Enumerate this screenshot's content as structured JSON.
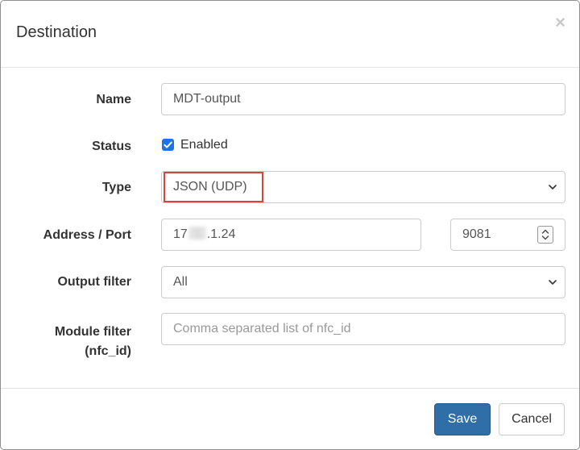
{
  "dialog": {
    "title": "Destination",
    "close_glyph": "×"
  },
  "form": {
    "name": {
      "label": "Name",
      "value": "MDT-output"
    },
    "status": {
      "label": "Status",
      "checkbox_label": "Enabled",
      "checked": true
    },
    "type": {
      "label": "Type",
      "selected": "JSON (UDP)"
    },
    "address": {
      "label": "Address / Port",
      "value_start": "17",
      "value_end": ".1.24",
      "port": "9081"
    },
    "output_filter": {
      "label": "Output filter",
      "selected": "All"
    },
    "module_filter": {
      "label_line1": "Module filter",
      "label_line2": "(nfc_id)",
      "placeholder": "Comma separated list of nfc_id"
    }
  },
  "footer": {
    "save_label": "Save",
    "cancel_label": "Cancel"
  },
  "colors": {
    "primary": "#2f6ea6",
    "highlight": "#d9423f",
    "checkbox": "#1a73e8"
  }
}
